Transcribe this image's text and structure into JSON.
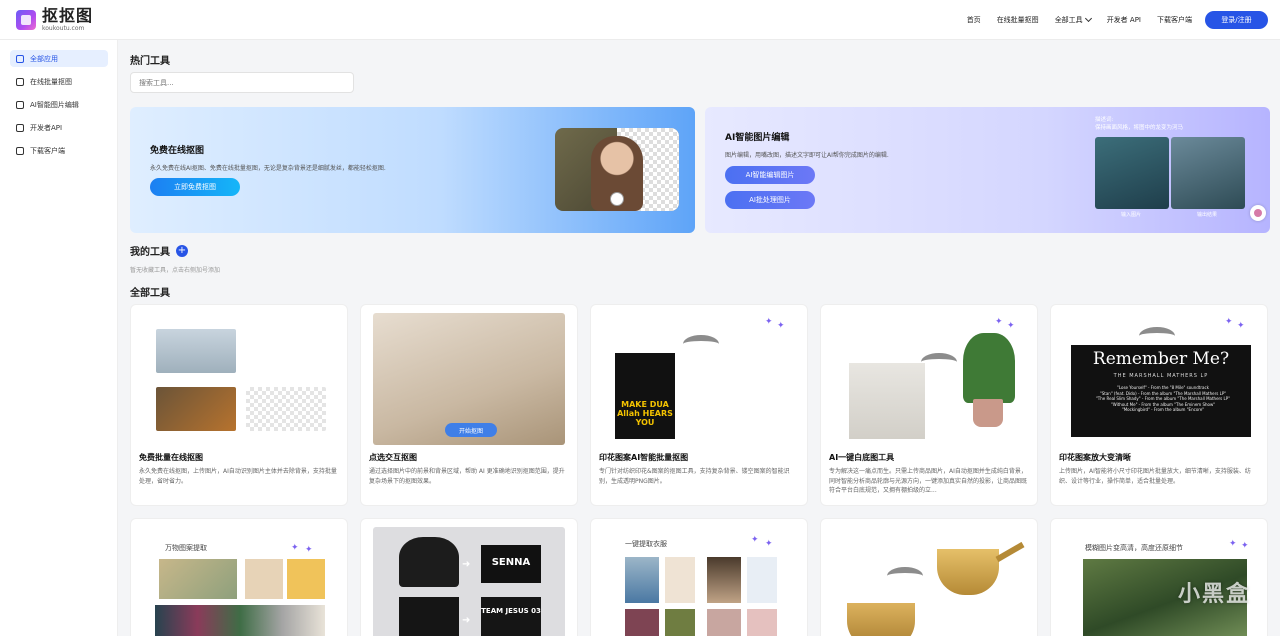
{
  "logo": {
    "name": "抠抠图",
    "domain": "koukoutu.com"
  },
  "nav": {
    "items": [
      "首页",
      "在线批量抠图",
      "全部工具",
      "开发者 API",
      "下载客户端"
    ],
    "login_label": "登录/注册"
  },
  "sidebar": {
    "items": [
      {
        "label": "全部应用",
        "icon": "apps-icon",
        "active": true
      },
      {
        "label": "在线批量抠图",
        "icon": "batch-icon",
        "active": false
      },
      {
        "label": "AI智能图片编辑",
        "icon": "edit-icon",
        "active": false
      },
      {
        "label": "开发者API",
        "icon": "api-icon",
        "active": false
      },
      {
        "label": "下载客户端",
        "icon": "download-icon",
        "active": false
      }
    ]
  },
  "main": {
    "hot_title": "热门工具",
    "search_placeholder": "搜索工具...",
    "banner_matting": {
      "title": "免费在线抠图",
      "desc": "永久免费在线AI抠图、免费在线批量抠图，无论是复杂背景还是细腻发丝，都能轻松抠图.",
      "button": "立即免费抠图"
    },
    "banner_ai": {
      "title": "AI智能图片编辑",
      "desc": "图片编辑，用嘴改图，描述文字即可让AI帮你完成图片的编辑.",
      "button1": "AI智能编辑图片",
      "button2": "AI批处理图片",
      "caption_line1": "描述词:",
      "caption_line2": "保持画面风格，将图中的龙变为河马",
      "label_input": "输入图片",
      "label_output": "输出结果"
    },
    "my_tools_title": "我的工具",
    "my_tools_plus": "+",
    "my_tools_empty": "暂无收藏工具，点击右侧加号添加",
    "all_tools_title": "全部工具",
    "cards": [
      {
        "title": "免费批量在线抠图",
        "desc": "永久免费在线抠图，上传图片，AI自动识别图片主体并去除背景，支持批量处理，省时省力。"
      },
      {
        "title": "点选交互抠图",
        "desc": "通过选择图片中的前景和背景区域，帮助 AI 更准确地识别抠图范围，提升复杂场景下的抠图效果。",
        "overlay_button": "开始抠图"
      },
      {
        "title": "印花图案AI智能批量抠图",
        "desc": "专门针对纺织印花&图案的抠图工具，支持复杂背景、镂空图案的智能识别，生成透明PNG图片。",
        "art_text": "MAKE DUA Allah HEARS YOU"
      },
      {
        "title": "AI一键白底图工具",
        "desc": "专为解决这一痛点而生。只需上传商品图片，AI自动抠图并生成纯白背景，同时智能分析商品轮廓与光源方向，一键添加真实自然的投影，让商品图既符合平台白底规范，又拥有棚拍级的立..."
      },
      {
        "title": "印花图案放大变清晰",
        "desc": "上传图片，AI智能将小尺寸印花图片批量放大，细节清晰，支持服装、纺织、设计等行业，操作简单，适合批量处理。",
        "art_title": "Remember Me?",
        "art_sub": "THE MARSHALL MATHERS LP",
        "art_lines": [
          "\"Lose Yourself\" - From the \"8 Mile\" soundtrack",
          "\"Stan\" (feat. Dido) - From the album \"The Marshall Mathers LP\"",
          "\"The Real Slim Shady\" - From the album \"The Marshall Mathers LP\"",
          "\"Without Me\" - From the album \"The Eminem Show\"",
          "\"Mockingbird\" - From the album \"Encore\""
        ]
      },
      {
        "title": "",
        "inner_label": "万物图案提取"
      },
      {
        "title": "",
        "art_text1": "SENNA",
        "art_text2": "TEAM JESUS 03"
      },
      {
        "title": "",
        "inner_label": "一键提取衣服"
      },
      {
        "title": ""
      },
      {
        "title": "",
        "inner_label": "模糊图片变高清，高度还原细节"
      }
    ],
    "watermark": "小黑盒"
  },
  "colors": {
    "accent": "#2754e6",
    "active_bg": "#e6efff"
  }
}
